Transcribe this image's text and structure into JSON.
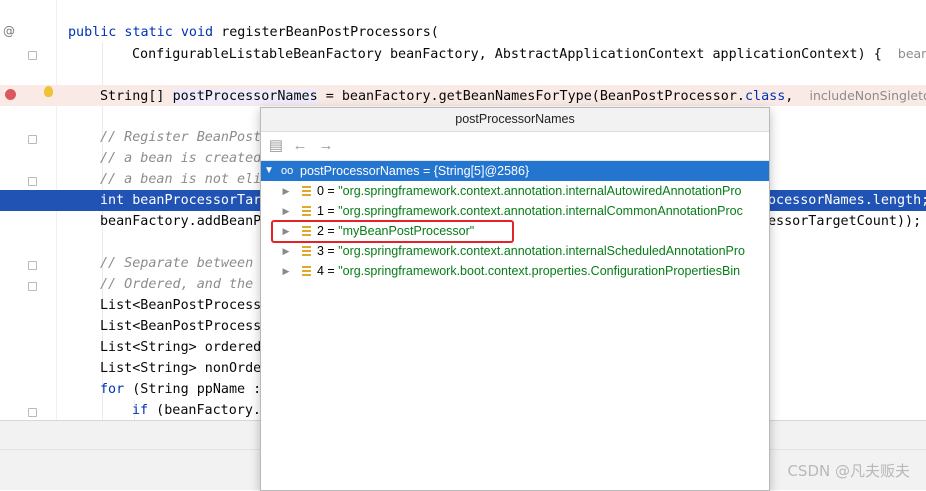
{
  "editor": {
    "gutter": {
      "annotation_glyph": "@"
    },
    "lines": [
      {
        "code": "public static void registerBeanPostProcessors("
      },
      {
        "code": "ConfigurableListableBeanFactory beanFactory, AbstractApplicationContext applicationContext) {",
        "hint": "beanF"
      },
      {
        "code_prefix": "String[] ",
        "code_var": "postProcessorNames",
        "code_rest": " = beanFactory.getBeanNamesForType(BeanPostProcessor.",
        "code_kw": "class",
        "code_comma": ",",
        "hint": "includeNonSingletons"
      },
      {
        "code": "// Register BeanPost"
      },
      {
        "code": "// a bean is created"
      },
      {
        "code": "// a bean is not eli"
      },
      {
        "code_kw": "int",
        "code": " beanProcessorTar",
        "code_tail": "ocessorNames.length;"
      },
      {
        "code": "beanFactory.addBeanP",
        "code_tail": "essorTargetCount));"
      },
      {
        "code": "// Separate between"
      },
      {
        "code": "// Ordered, and the"
      },
      {
        "code": "List<BeanPostProcess"
      },
      {
        "code": "List<BeanPostProcess"
      },
      {
        "code": "List<String> ordered"
      },
      {
        "code": "List<String> nonOrde"
      },
      {
        "code_kw": "for",
        "code": " (String ppName :"
      },
      {
        "code_kw": "if",
        "code": " (beanFactory."
      }
    ]
  },
  "popup": {
    "title": "postProcessorNames",
    "toolbar": {
      "icon_names": [
        "hierarchy-icon",
        "back-arrow-icon",
        "forward-arrow-icon"
      ]
    },
    "root": {
      "label": "postProcessorNames = {String[5]@2586}"
    },
    "items": [
      {
        "index": "0",
        "value": "\"org.springframework.context.annotation.internalAutowiredAnnotationPro"
      },
      {
        "index": "1",
        "value": "\"org.springframework.context.annotation.internalCommonAnnotationProc"
      },
      {
        "index": "2",
        "value": "\"myBeanPostProcessor\""
      },
      {
        "index": "3",
        "value": "\"org.springframework.context.annotation.internalScheduledAnnotationPro"
      },
      {
        "index": "4",
        "value": "\"org.springframework.boot.context.properties.ConfigurationPropertiesBin"
      }
    ],
    "highlighted_item": "2",
    "highlight_color": "#e2242a"
  },
  "watermark": "CSDN @凡夫贩夫",
  "colors": {
    "keyword": "#0033b3",
    "string": "#067d17",
    "selection": "#2153b5",
    "breakpoint_line": "#faeae6"
  }
}
